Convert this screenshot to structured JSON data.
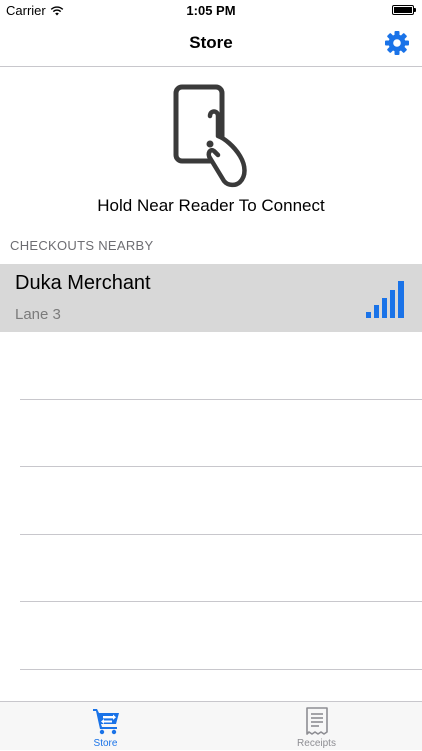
{
  "status_bar": {
    "carrier": "Carrier",
    "time": "1:05 PM"
  },
  "nav": {
    "title": "Store",
    "settings_icon": "gear-icon"
  },
  "hero": {
    "icon": "phone-tap-icon",
    "text": "Hold Near Reader To Connect"
  },
  "section": {
    "header": "CHECKOUTS NEARBY"
  },
  "checkouts": [
    {
      "name": "Duka Merchant",
      "lane": "Lane 3",
      "signal_icon": "signal-strength-icon"
    }
  ],
  "tabs": [
    {
      "label": "Store",
      "icon": "cart-icon",
      "selected": true
    },
    {
      "label": "Receipts",
      "icon": "receipt-icon",
      "selected": false
    }
  ],
  "colors": {
    "accent": "#1a73e8",
    "selected_row": "#d8d8d8",
    "inactive_tab": "#8e8e93"
  }
}
